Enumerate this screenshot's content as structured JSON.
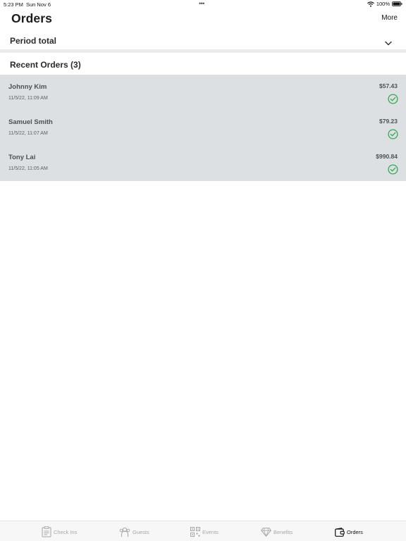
{
  "status_bar": {
    "time": "5:23 PM",
    "date": "Sun Nov 6",
    "battery": "100%"
  },
  "header": {
    "title": "Orders",
    "more_label": "More"
  },
  "period": {
    "label": "Period total"
  },
  "recent": {
    "heading": "Recent Orders (3)",
    "orders": [
      {
        "name": "Johnny Kim",
        "date": "11/5/22, 11:09 AM",
        "amount": "$57.43",
        "status_icon": "check-circle-icon"
      },
      {
        "name": "Samuel Smith",
        "date": "11/5/22, 11:07 AM",
        "amount": "$79.23",
        "status_icon": "check-circle-icon"
      },
      {
        "name": "Tony Lai",
        "date": "11/5/22, 11:05 AM",
        "amount": "$990.84",
        "status_icon": "check-circle-icon"
      }
    ]
  },
  "tab_bar": {
    "tabs": [
      {
        "label": "Check Ins",
        "icon": "clipboard-icon",
        "active": false
      },
      {
        "label": "Guests",
        "icon": "guests-icon",
        "active": false
      },
      {
        "label": "Events",
        "icon": "qr-code-icon",
        "active": false
      },
      {
        "label": "Benefits",
        "icon": "diamond-icon",
        "active": false
      },
      {
        "label": "Orders",
        "icon": "wallet-icon",
        "active": true
      }
    ]
  },
  "colors": {
    "accent_success": "#34a853",
    "list_background": "#dde0e3",
    "inactive_tab": "#a6a6a8"
  }
}
